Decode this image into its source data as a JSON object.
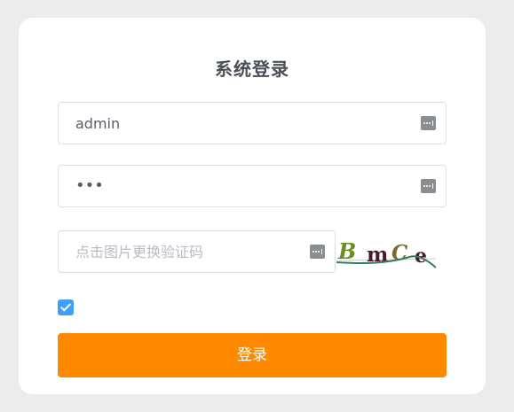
{
  "login": {
    "title": "系统登录",
    "username_value": "admin",
    "password_masked": "•••",
    "captcha_placeholder": "点击图片更换验证码",
    "captcha_text": "B mC e",
    "remember_checked": true,
    "submit_label": "登录"
  },
  "colors": {
    "button": "#ff8a00",
    "checkbox": "#409eff",
    "page_bg": "#ececec"
  },
  "icons": {
    "field_icon": "password-manager-key-icon"
  }
}
